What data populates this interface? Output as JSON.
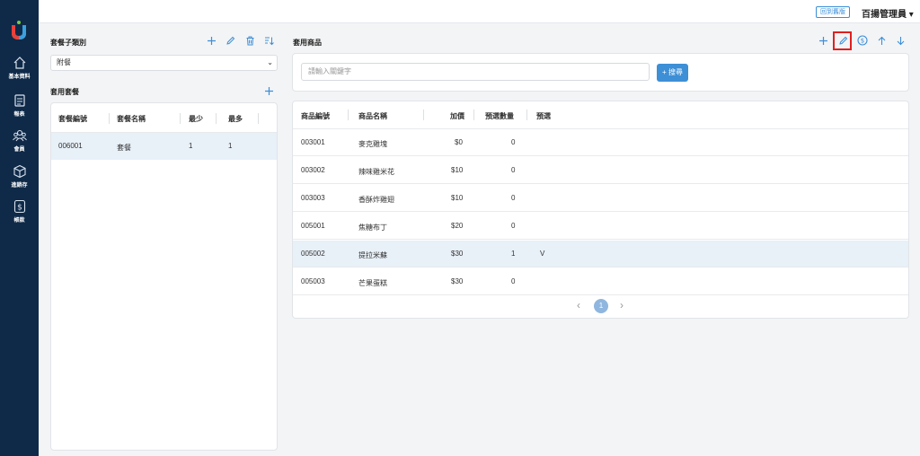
{
  "header": {
    "back_button": "回到舊版",
    "user_menu": "百揚管理員 ▾"
  },
  "sidebar": {
    "items": [
      {
        "label": "基本資料",
        "icon": "home-icon"
      },
      {
        "label": "報表",
        "icon": "document-icon"
      },
      {
        "label": "會員",
        "icon": "users-icon"
      },
      {
        "label": "進銷存",
        "icon": "box-icon"
      },
      {
        "label": "帳款",
        "icon": "dollar-icon"
      }
    ]
  },
  "left": {
    "category_title": "套餐子類別",
    "category_select": "附餐",
    "set_meal_title": "套用套餐",
    "columns": [
      "套餐編號",
      "套餐名稱",
      "最少",
      "最多"
    ],
    "rows": [
      {
        "id": "006001",
        "name": "套餐",
        "min": "1",
        "max": "1"
      }
    ]
  },
  "right": {
    "title": "套用商品",
    "search_placeholder": "請輸入關鍵字",
    "search_button": "+ 搜尋",
    "columns": [
      "商品編號",
      "商品名稱",
      "加價",
      "預選數量",
      "預選"
    ],
    "rows": [
      {
        "id": "003001",
        "name": "麥克雞塊",
        "price": "$0",
        "qty": "0",
        "pre": ""
      },
      {
        "id": "003002",
        "name": "辣味雞米花",
        "price": "$10",
        "qty": "0",
        "pre": ""
      },
      {
        "id": "003003",
        "name": "香酥炸雞翅",
        "price": "$10",
        "qty": "0",
        "pre": ""
      },
      {
        "id": "005001",
        "name": "焦糖布丁",
        "price": "$20",
        "qty": "0",
        "pre": ""
      },
      {
        "id": "005002",
        "name": "提拉米蘇",
        "price": "$30",
        "qty": "1",
        "pre": "V"
      },
      {
        "id": "005003",
        "name": "芒果蛋糕",
        "price": "$30",
        "qty": "0",
        "pre": ""
      }
    ],
    "pagination": {
      "current": "1",
      "prev": "‹",
      "next": "›"
    }
  },
  "colors": {
    "sidebar": "#0f2a48",
    "accent": "#3d8fd6",
    "selected_row": "#e8f0f8",
    "highlight": "#e02020"
  }
}
